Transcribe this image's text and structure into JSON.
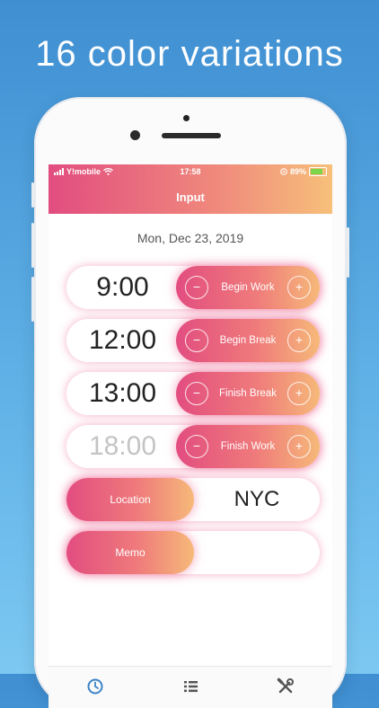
{
  "headline": "16 color variations",
  "status_bar": {
    "carrier": "Y!mobile",
    "time": "17:58",
    "battery": "89%"
  },
  "nav": {
    "title": "Input"
  },
  "date": "Mon, Dec 23, 2019",
  "time_rows": [
    {
      "time": "9:00",
      "label": "Begin Work",
      "dimmed": false
    },
    {
      "time": "12:00",
      "label": "Begin Break",
      "dimmed": false
    },
    {
      "time": "13:00",
      "label": "Finish Break",
      "dimmed": false
    },
    {
      "time": "18:00",
      "label": "Finish Work",
      "dimmed": true
    }
  ],
  "location": {
    "label": "Location",
    "value": "NYC"
  },
  "memo": {
    "label": "Memo",
    "value": ""
  },
  "tabs": [
    {
      "icon": "clock-icon",
      "active": true
    },
    {
      "icon": "list-icon",
      "active": false
    },
    {
      "icon": "tools-icon",
      "active": false
    }
  ],
  "colors": {
    "accent_start": "#e24d80",
    "accent_end": "#f6b979",
    "tab_active": "#3c84c8",
    "tab_inactive": "#555555"
  }
}
